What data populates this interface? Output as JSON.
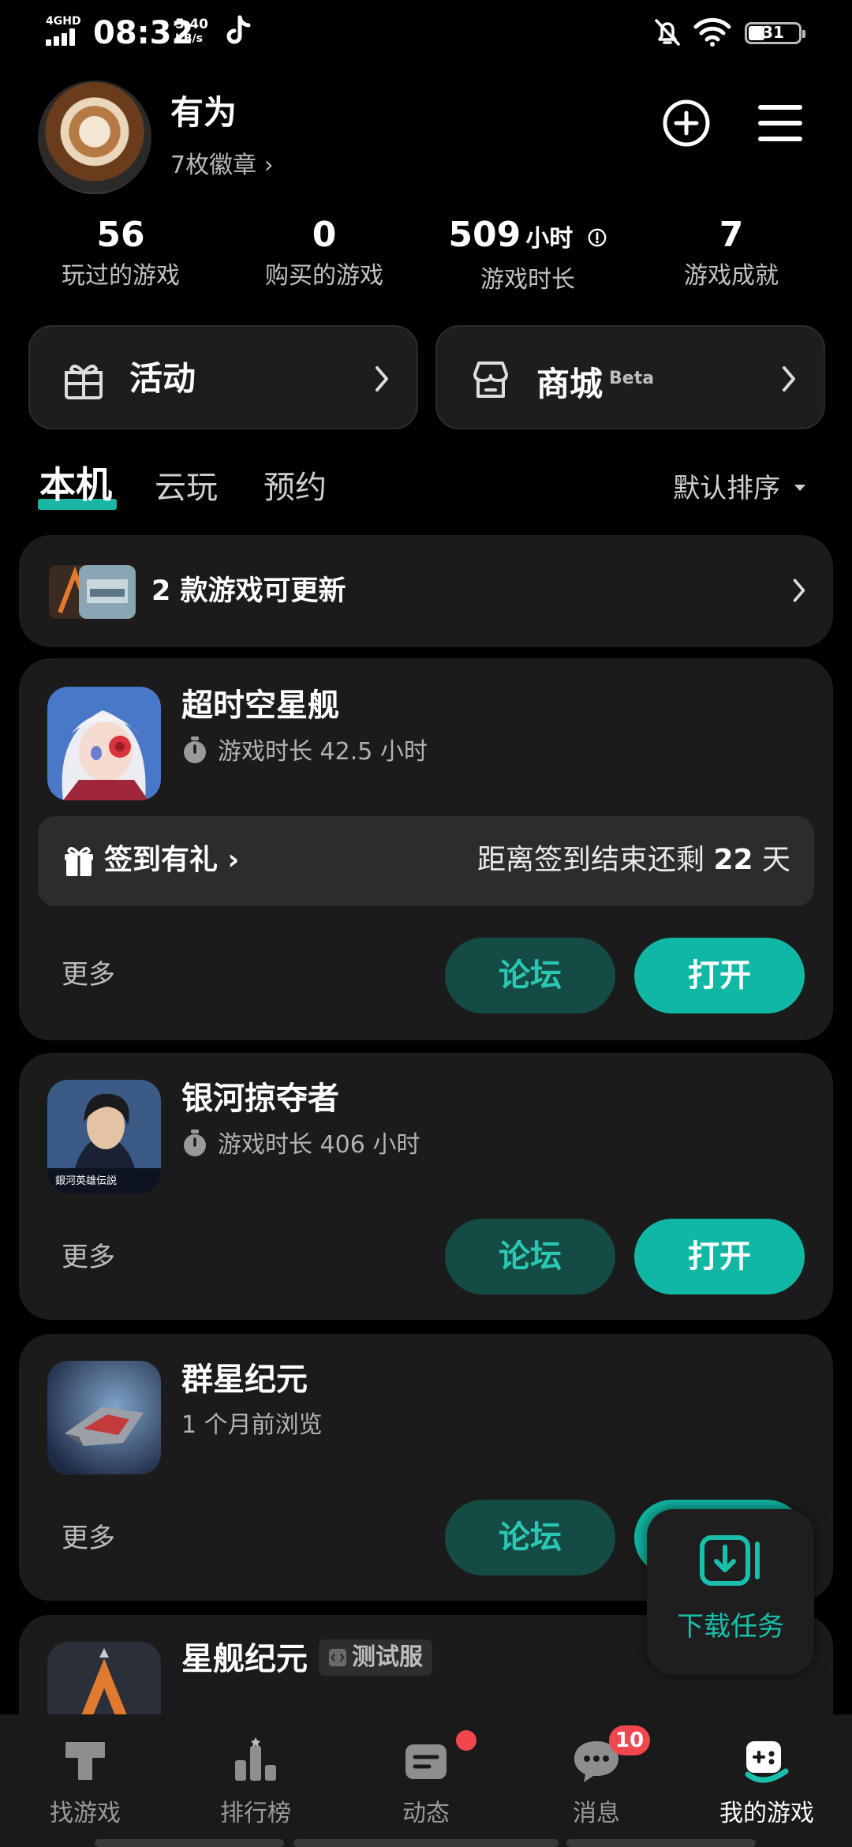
{
  "status_bar": {
    "network": "4GHD",
    "time": "08:32",
    "speed_value": "5.40",
    "speed_unit": "KB/s",
    "battery": "31",
    "icons": [
      "signal-icon",
      "tiktok-icon",
      "bell-muted-icon",
      "wifi-icon",
      "battery-icon"
    ]
  },
  "profile": {
    "name": "有为",
    "badges": "7枚徽章 ›"
  },
  "stats": [
    {
      "value": "56",
      "unit": "",
      "label": "玩过的游戏"
    },
    {
      "value": "0",
      "unit": "",
      "label": "购买的游戏"
    },
    {
      "value": "509",
      "unit": "小时",
      "label": "游戏时长"
    },
    {
      "value": "7",
      "unit": "",
      "label": "游戏成就"
    }
  ],
  "shortcuts": {
    "activity": "活动",
    "store": "商城",
    "store_tag": "Beta"
  },
  "tabs": {
    "local": "本机",
    "cloud": "云玩",
    "reserve": "预约",
    "sort": "默认排序"
  },
  "update_banner": "2 款游戏可更新",
  "games": [
    {
      "name": "超时空星舰",
      "subtitle": "游戏时长 42.5 小时",
      "more": "更多",
      "forum": "论坛",
      "open": "打开",
      "signin": {
        "label": "签到有礼 ›",
        "remaining_prefix": "距离签到结束还剩 ",
        "remaining_days": "22",
        "remaining_suffix": " 天"
      }
    },
    {
      "name": "银河掠夺者",
      "subtitle": "游戏时长 406 小时",
      "more": "更多",
      "forum": "论坛",
      "open": "打开"
    },
    {
      "name": "群星纪元",
      "subtitle": "1 个月前浏览",
      "more": "更多",
      "forum": "论坛",
      "open": "打开"
    },
    {
      "name": "星舰纪元",
      "tag": "测试服"
    }
  ],
  "download_task": "下载任务",
  "bottom_nav": [
    {
      "label": "找游戏"
    },
    {
      "label": "排行榜"
    },
    {
      "label": "动态"
    },
    {
      "label": "消息",
      "badge": "10"
    },
    {
      "label": "我的游戏"
    }
  ],
  "colors": {
    "accent": "#10b7a4",
    "forum_bg": "#154b45",
    "card_bg": "#1b1b1b",
    "badge_red": "#f0474d"
  }
}
